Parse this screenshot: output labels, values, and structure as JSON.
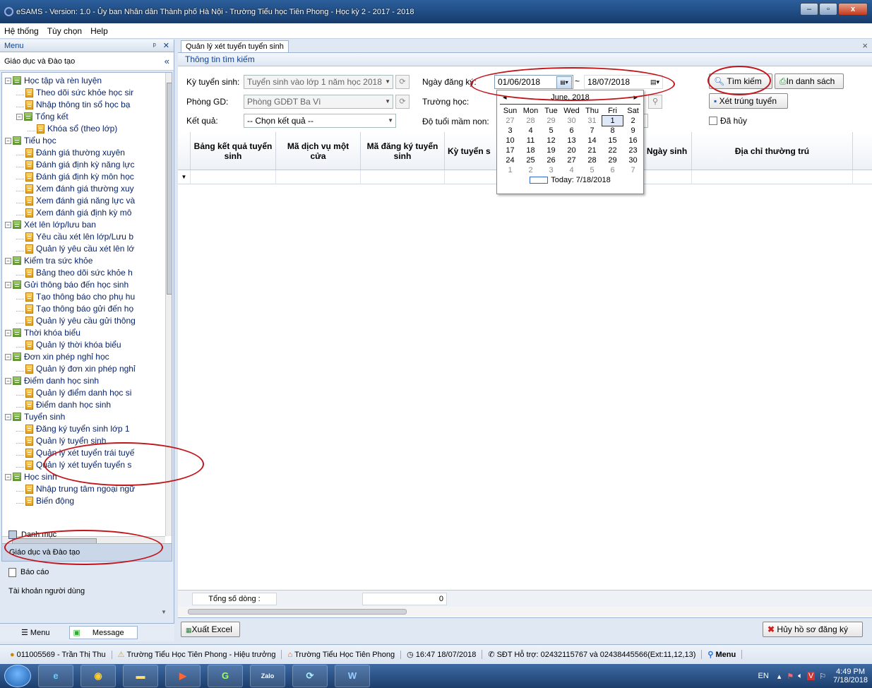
{
  "window": {
    "title": "eSAMS - Version: 1.0 - Ủy ban Nhân dân Thành phố Hà Nội - Trường Tiểu học Tiên Phong - Học kỳ 2 - 2017 - 2018",
    "min": "–",
    "max": "▫",
    "close": "x"
  },
  "menubar": [
    "Hệ thống",
    "Tùy chọn",
    "Help"
  ],
  "leftpanel": {
    "title": "Menu",
    "pin": "ᵖ",
    "close": "✕",
    "section": "Giáo dục và Đào tạo",
    "collapse": "«"
  },
  "tree": [
    {
      "t": "Học tập và rèn luyện",
      "l": 0,
      "f": 1
    },
    {
      "t": "Theo dõi sức khỏe học sir",
      "l": 1
    },
    {
      "t": "Nhập thông tin sổ học bạ",
      "l": 1
    },
    {
      "t": "Tổng kết",
      "l": 1,
      "f": 1
    },
    {
      "t": "Khóa sổ (theo lớp)",
      "l": 2
    },
    {
      "t": "Tiểu học",
      "l": 0,
      "f": 1
    },
    {
      "t": "Đánh giá thường xuyên",
      "l": 1
    },
    {
      "t": "Đánh giá định kỳ năng lực",
      "l": 1
    },
    {
      "t": "Đánh giá định kỳ môn học",
      "l": 1
    },
    {
      "t": "Xem đánh giá thường xuy",
      "l": 1
    },
    {
      "t": "Xem đánh giá năng lực và",
      "l": 1
    },
    {
      "t": "Xem đánh giá định kỳ mô",
      "l": 1
    },
    {
      "t": "Xét lên lớp/lưu ban",
      "l": 0,
      "f": 1
    },
    {
      "t": "Yêu cầu xét lên lớp/Lưu b",
      "l": 1
    },
    {
      "t": "Quản lý yêu cầu xét lên lớ",
      "l": 1
    },
    {
      "t": "Kiểm tra sức khỏe",
      "l": 0,
      "f": 1
    },
    {
      "t": "Bảng theo dõi sức khỏe h",
      "l": 1
    },
    {
      "t": "Gửi thông báo đến học sinh",
      "l": 0,
      "f": 1
    },
    {
      "t": "Tạo thông báo cho phụ hu",
      "l": 1
    },
    {
      "t": "Tạo thông báo gửi đến họ",
      "l": 1
    },
    {
      "t": "Quản lý yêu cầu gửi thông",
      "l": 1
    },
    {
      "t": "Thời khóa biểu",
      "l": 0,
      "f": 1
    },
    {
      "t": "Quản lý thời khóa biểu",
      "l": 1
    },
    {
      "t": "Đơn xin phép nghỉ học",
      "l": 0,
      "f": 1
    },
    {
      "t": "Quản lý đơn xin phép nghỉ",
      "l": 1
    },
    {
      "t": "Điểm danh học sinh",
      "l": 0,
      "f": 1
    },
    {
      "t": "Quản lý điểm danh học si",
      "l": 1
    },
    {
      "t": "Điểm danh học sinh",
      "l": 1
    },
    {
      "t": "Tuyển sinh",
      "l": 0,
      "f": 1
    },
    {
      "t": "Đăng ký tuyển sinh lớp 1",
      "l": 1
    },
    {
      "t": "Quản lý tuyển sinh",
      "l": 1
    },
    {
      "t": "Quản lý xét tuyển trái tuyế",
      "l": 1
    },
    {
      "t": "Quản lý xét tuyển tuyển s",
      "l": 1
    },
    {
      "t": "Học sinh",
      "l": 0,
      "f": 1
    },
    {
      "t": "Nhập trung tâm ngoại ngữ",
      "l": 1
    },
    {
      "t": "Biến động",
      "l": 1
    }
  ],
  "nav": {
    "danhmuc": "Danh mục",
    "gddt": "Giáo dục và Đào tạo",
    "baocao": "Báo cáo",
    "taikhoan": "Tài khoản người dùng"
  },
  "bottomtabs": {
    "menu": "Menu",
    "message": "Message"
  },
  "doctab": {
    "label": "Quản lý xét tuyển tuyển sinh",
    "close": "×"
  },
  "search": {
    "header": "Thông tin tìm kiếm",
    "ky_label": "Kỳ tuyển sinh:",
    "ky_value": "Tuyển sinh vào lớp 1 năm học 2018",
    "phong_label": "Phòng GD:",
    "phong_value": "Phòng GDĐT Ba Vì",
    "ketqua_label": "Kết quả:",
    "ketqua_value": "-- Chọn kết quả --",
    "ngay_label": "Ngày đăng ký:",
    "from": "01/06/2018",
    "sep": "~",
    "to": "18/07/2018",
    "truong_label": "Trường học:",
    "dotuoi_label": "Độ tuổi mầm non:",
    "btn_search": "Tìm kiếm",
    "btn_print": "In danh sách",
    "btn_xet": "Xét trúng tuyển",
    "dahuy": "Đã hủy"
  },
  "calendar": {
    "month": "June, 2018",
    "dow": [
      "Sun",
      "Mon",
      "Tue",
      "Wed",
      "Thu",
      "Fri",
      "Sat"
    ],
    "weeks": [
      [
        "27",
        "28",
        "29",
        "30",
        "31",
        "1",
        "2"
      ],
      [
        "3",
        "4",
        "5",
        "6",
        "7",
        "8",
        "9"
      ],
      [
        "10",
        "11",
        "12",
        "13",
        "14",
        "15",
        "16"
      ],
      [
        "17",
        "18",
        "19",
        "20",
        "21",
        "22",
        "23"
      ],
      [
        "24",
        "25",
        "26",
        "27",
        "28",
        "29",
        "30"
      ],
      [
        "1",
        "2",
        "3",
        "4",
        "5",
        "6",
        "7"
      ]
    ],
    "today": "Today: 7/18/2018"
  },
  "grid": {
    "columns": [
      "Bảng kết quả tuyển sinh",
      "Mã dịch vụ một cửa",
      "Mã đăng ký tuyển sinh",
      "Kỳ tuyển s",
      "",
      "Ngày sinh",
      "Địa chỉ thường trú"
    ],
    "total_label": "Tổng số dòng :",
    "total_value": "0"
  },
  "actions": {
    "export": "Xuất Excel",
    "cancel": "Hủy hồ sơ đăng ký"
  },
  "status": {
    "user": "011005569 - Trần Thị Thu",
    "role": "Trường Tiểu Học Tiên Phong - Hiệu trưởng",
    "school": "Trường Tiểu Học Tiên Phong",
    "time": "16:47 18/07/2018",
    "support": "SĐT Hỗ trợ: 02432115767 và 02438445566(Ext:11,12,13)",
    "menu": "Menu"
  },
  "taskbar": {
    "lang": "EN",
    "time": "4:49 PM",
    "date": "7/18/2018",
    "zalo": "Zalo"
  },
  "colors": {
    "highlight": "#c2151b"
  }
}
